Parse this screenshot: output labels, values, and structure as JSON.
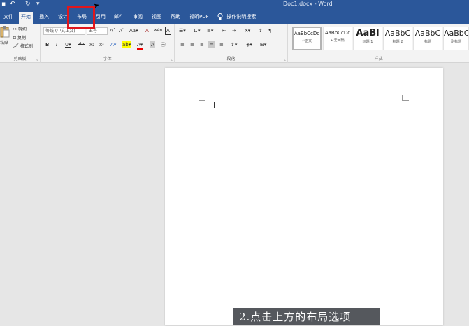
{
  "titlebar": {
    "document_title": "Doc1.docx  -  Word",
    "save_glyph": "▪",
    "undo_glyph": "↶",
    "redo_glyph": "↻",
    "customize_glyph": "▾"
  },
  "tabs": [
    {
      "label": "文件"
    },
    {
      "label": "开始"
    },
    {
      "label": "插入"
    },
    {
      "label": "设计"
    },
    {
      "label": "布局"
    },
    {
      "label": "引用"
    },
    {
      "label": "邮件"
    },
    {
      "label": "审阅"
    },
    {
      "label": "视图"
    },
    {
      "label": "帮助"
    },
    {
      "label": "福昕PDF"
    }
  ],
  "tell_me": {
    "icon": "lightbulb-icon",
    "label": "操作说明搜索"
  },
  "clipboard": {
    "paste": "粘贴",
    "cut": "剪切",
    "copy": "复制",
    "format_painter": "格式刷",
    "group_label": "剪贴板",
    "launcher": "⌞"
  },
  "font": {
    "font_name": "等线 (中文正文)",
    "font_size": "五号",
    "grow": "A˄",
    "shrink": "A˅",
    "change_case": "Aa▾",
    "clear": "A̶",
    "phonetic": "wén",
    "char_border": "A",
    "bold": "B",
    "italic": "I",
    "underline": "U▾",
    "strike": "abc",
    "subscript": "x₂",
    "superscript": "x²",
    "effects": "A▾",
    "highlight": "ab▾",
    "font_color": "A▾",
    "shading": "A",
    "enclose": "㊀",
    "group_label": "字体",
    "launcher": "⌞"
  },
  "paragraph": {
    "bullets": "☰▾",
    "numbering": "⒈▾",
    "multilevel": "≡▾",
    "dec_indent": "⇤",
    "inc_indent": "⇥",
    "chinese_layout": "X▾",
    "sort": "↕",
    "show_marks": "¶",
    "align_left": "≡",
    "center": "≡",
    "align_right": "≡",
    "justify": "≡",
    "distributed": "≡",
    "line_spacing": "↕▾",
    "shading": "◈▾",
    "borders": "⊞▾",
    "group_label": "段落",
    "launcher": "⌞"
  },
  "styles": {
    "items": [
      {
        "sample": "AaBbCcDc",
        "name": "↵正文"
      },
      {
        "sample": "AaBbCcDc",
        "name": "↵无间隔"
      },
      {
        "sample": "AaBl",
        "name": "标题 1"
      },
      {
        "sample": "AaBbC",
        "name": "标题 2"
      },
      {
        "sample": "AaBbC",
        "name": "标题"
      },
      {
        "sample": "AaBbC",
        "name": "副标题"
      }
    ],
    "group_label": "样式"
  },
  "caption": {
    "text": "2.点击上方的布局选项"
  },
  "colors": {
    "brand": "#2b579a",
    "highlight_box": "#e0161c",
    "ribbon_bg": "#f3f3f3",
    "caption_bg": "#55585d"
  }
}
